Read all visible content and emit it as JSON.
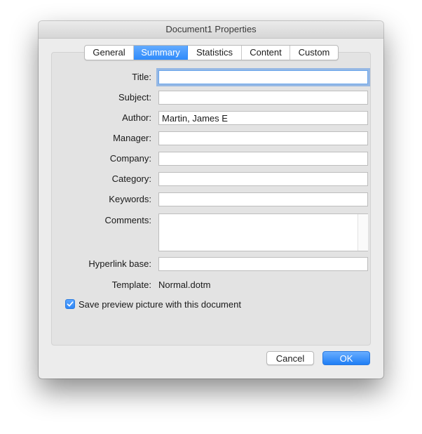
{
  "window": {
    "title": "Document1 Properties"
  },
  "tabs": [
    {
      "label": "General",
      "active": false
    },
    {
      "label": "Summary",
      "active": true
    },
    {
      "label": "Statistics",
      "active": false
    },
    {
      "label": "Content",
      "active": false
    },
    {
      "label": "Custom",
      "active": false
    }
  ],
  "fields": {
    "title": {
      "label": "Title:",
      "value": ""
    },
    "subject": {
      "label": "Subject:",
      "value": ""
    },
    "author": {
      "label": "Author:",
      "value": "Martin, James E"
    },
    "manager": {
      "label": "Manager:",
      "value": ""
    },
    "company": {
      "label": "Company:",
      "value": ""
    },
    "category": {
      "label": "Category:",
      "value": ""
    },
    "keywords": {
      "label": "Keywords:",
      "value": ""
    },
    "comments": {
      "label": "Comments:",
      "value": ""
    },
    "hyperlink_base": {
      "label": "Hyperlink base:",
      "value": ""
    },
    "template": {
      "label": "Template:",
      "value": "Normal.dotm"
    }
  },
  "save_preview": {
    "label": "Save preview picture with this document",
    "checked": true
  },
  "buttons": {
    "cancel": "Cancel",
    "ok": "OK"
  },
  "colors": {
    "accent": "#2f8bfb",
    "window_bg": "#ececec",
    "panel_bg": "#e3e3e3"
  }
}
